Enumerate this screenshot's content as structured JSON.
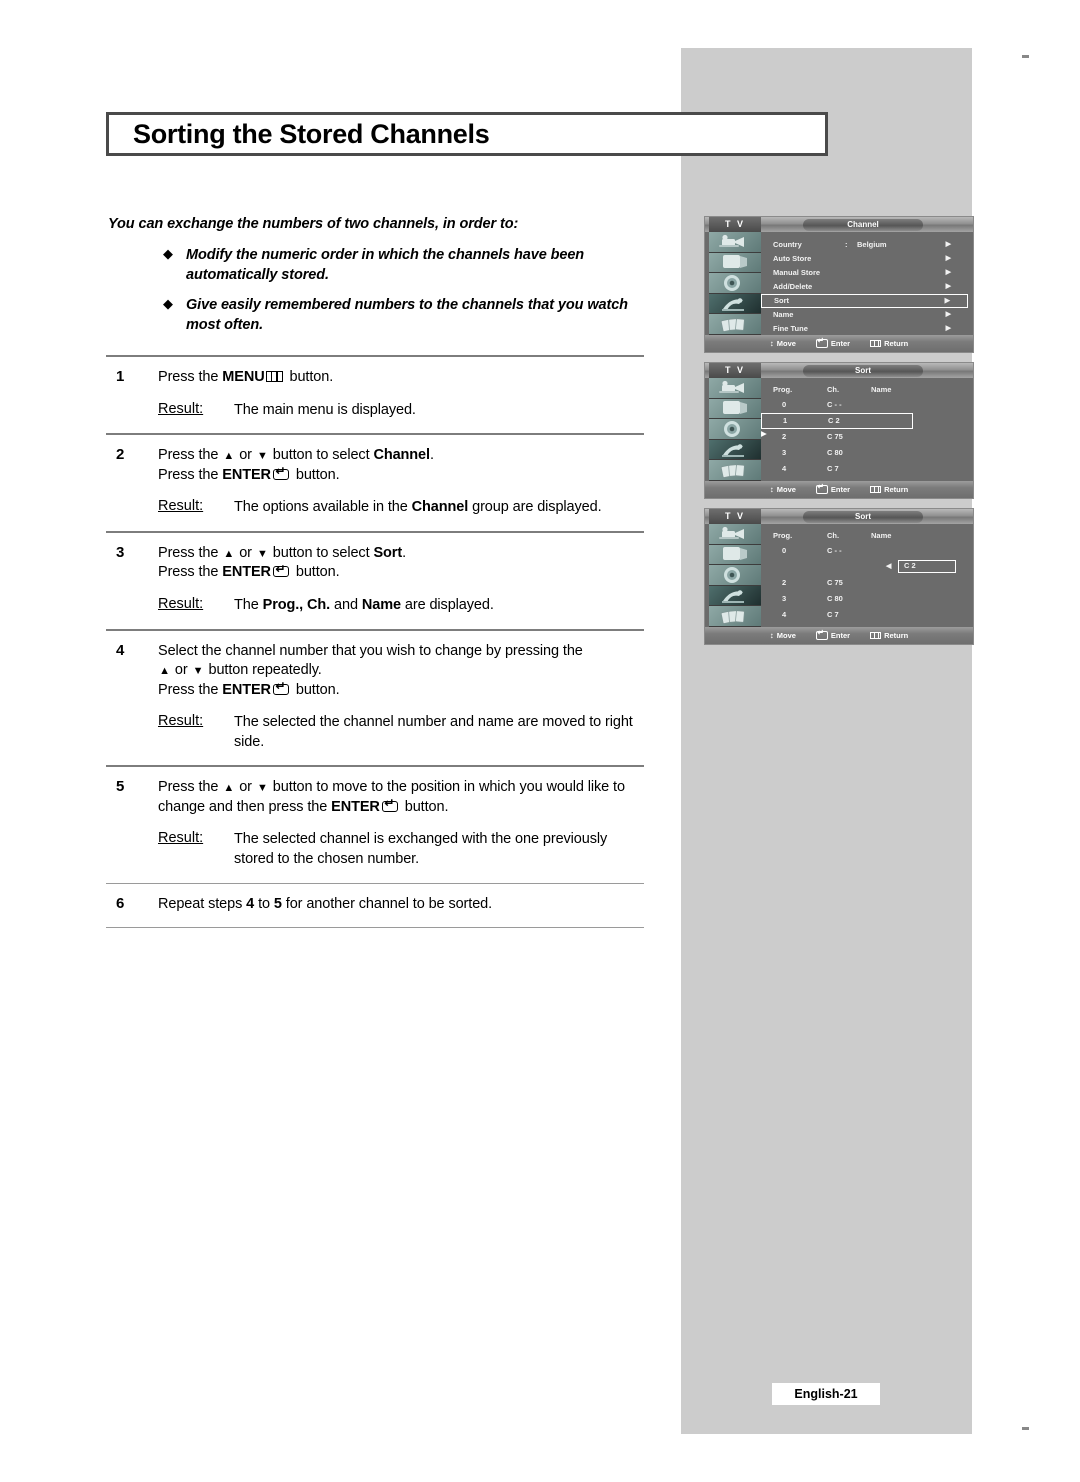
{
  "page": {
    "title": "Sorting the Stored Channels",
    "footer_label": "English-21"
  },
  "intro": {
    "lead": "You can exchange the numbers of two channels, in order to:",
    "bullets": [
      "Modify the numeric order in which the channels have been automatically stored.",
      "Give easily remembered numbers to the channels that you watch most often."
    ],
    "bullet_glyph": "◆"
  },
  "steps": [
    {
      "num": "1",
      "lines": [
        {
          "pre": "Press the ",
          "bold": "MENU",
          "icon": "menu-icon",
          "post": " button."
        }
      ],
      "result_label": "Result:",
      "result": "The main menu is displayed."
    },
    {
      "num": "2",
      "lines": [
        {
          "pre": "Press the ",
          "arrows": true,
          "mid": " button to select ",
          "bold": "Channel",
          "post": "."
        },
        {
          "pre": "Press the ",
          "bold": "ENTER",
          "icon": "enter-icon",
          "post": " button."
        }
      ],
      "result_label": "Result:",
      "result_pre": "The options available in the ",
      "result_bold": "Channel",
      "result_post": " group are displayed."
    },
    {
      "num": "3",
      "lines": [
        {
          "pre": "Press the ",
          "arrows": true,
          "mid": " button to select ",
          "bold": "Sort",
          "post": "."
        },
        {
          "pre": "Press the ",
          "bold": "ENTER",
          "icon": "enter-icon",
          "post": " button."
        }
      ],
      "result_label": "Result:",
      "result_pre": "The ",
      "result_bold": "Prog., Ch.",
      "result_mid": " and ",
      "result_bold2": "Name",
      "result_post": " are displayed."
    },
    {
      "num": "4",
      "lines": [
        {
          "text": "Select the channel number that you wish to change by pressing the"
        },
        {
          "arrows": true,
          "mid": " button repeatedly."
        },
        {
          "pre": "Press the ",
          "bold": "ENTER",
          "icon": "enter-icon",
          "post": " button."
        }
      ],
      "result_label": "Result:",
      "result": "The selected the channel number and name are moved to right side."
    },
    {
      "num": "5",
      "lines": [
        {
          "pre": "Press the ",
          "arrows": true,
          "mid": " button to move to the position in which you would like to change and then press the ",
          "bold": "ENTER",
          "icon": "enter-icon",
          "post": " button."
        }
      ],
      "result_label": "Result:",
      "result": "The selected channel is exchanged with the one previously stored to the chosen number."
    },
    {
      "num": "6",
      "lines": [
        {
          "pre": "Repeat steps ",
          "bold": "4",
          "mid": " to ",
          "bold2": "5",
          "post": " for another channel to be sorted."
        }
      ]
    }
  ],
  "osd": {
    "tv_label": "T V",
    "footer": {
      "move": "Move",
      "enter": "Enter",
      "return": "Return"
    },
    "screen1": {
      "header_title": "Channel",
      "items": [
        {
          "label": "Country",
          "colon": ":",
          "value": "Belgium",
          "selected": false
        },
        {
          "label": "Auto Store",
          "colon": "",
          "value": "",
          "selected": false
        },
        {
          "label": "Manual Store",
          "colon": "",
          "value": "",
          "selected": false
        },
        {
          "label": "Add/Delete",
          "colon": "",
          "value": "",
          "selected": false
        },
        {
          "label": "Sort",
          "colon": "",
          "value": "",
          "selected": true
        },
        {
          "label": "Name",
          "colon": "",
          "value": "",
          "selected": false
        },
        {
          "label": "Fine Tune",
          "colon": "",
          "value": "",
          "selected": false
        }
      ],
      "arrow_glyph": "▶"
    },
    "screen2": {
      "header_title": "Sort",
      "columns": {
        "prog": "Prog.",
        "ch": "Ch.",
        "name": "Name"
      },
      "rows": [
        {
          "prog": "0",
          "ch": "C - -",
          "name": "",
          "state": "normal"
        },
        {
          "prog": "1",
          "ch": "C 2",
          "name": "",
          "state": "selected-left"
        },
        {
          "prog": "2",
          "ch": "C 75",
          "name": "",
          "state": "normal"
        },
        {
          "prog": "3",
          "ch": "C 80",
          "name": "",
          "state": "normal"
        },
        {
          "prog": "4",
          "ch": "C 7",
          "name": "",
          "state": "normal"
        }
      ],
      "arrow_right": "▶"
    },
    "screen3": {
      "header_title": "Sort",
      "columns": {
        "prog": "Prog.",
        "ch": "Ch.",
        "name": "Name"
      },
      "rows": [
        {
          "prog": "0",
          "ch": "C - -",
          "name": "",
          "state": "normal"
        },
        {
          "prog": "",
          "ch": "C 2",
          "name": "",
          "state": "moved-right"
        },
        {
          "prog": "2",
          "ch": "C 75",
          "name": "",
          "state": "normal"
        },
        {
          "prog": "3",
          "ch": "C 80",
          "name": "",
          "state": "normal"
        },
        {
          "prog": "4",
          "ch": "C 7",
          "name": "",
          "state": "normal"
        }
      ],
      "arrow_left": "◀"
    }
  },
  "colors": {
    "panel_gray": "#cccccc",
    "osd_bg": "#6b6b6b",
    "rule": "#7d7d7d"
  }
}
